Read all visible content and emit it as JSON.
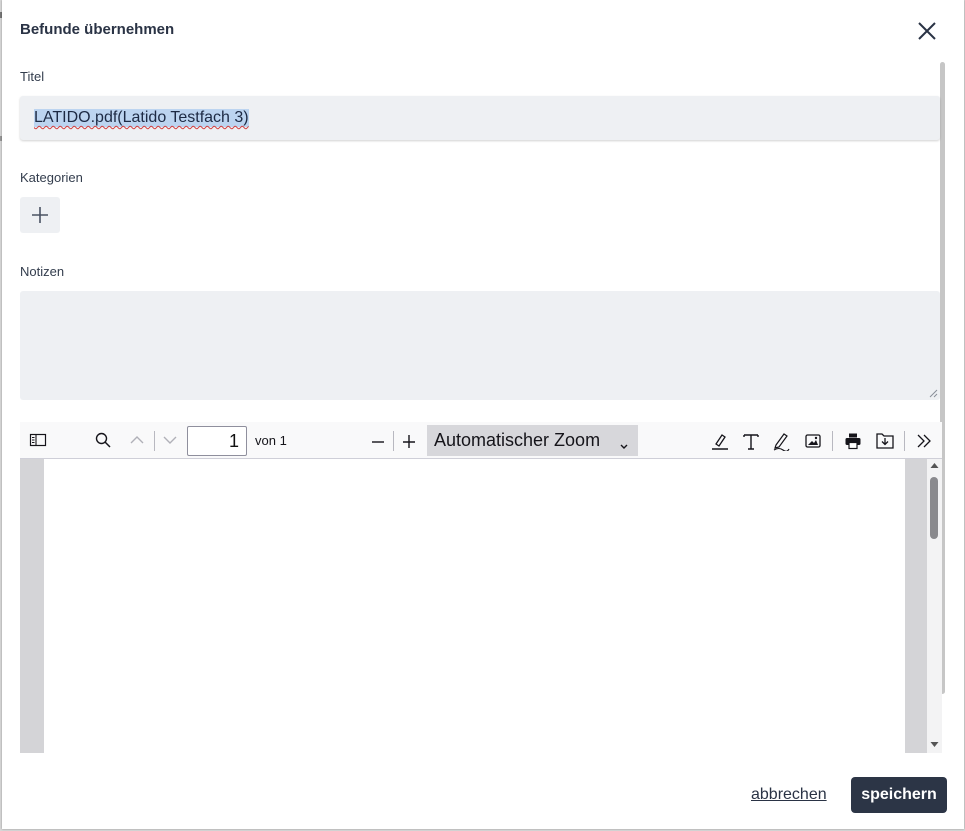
{
  "dialog": {
    "title": "Befunde übernehmen",
    "close_icon": "close-icon"
  },
  "form": {
    "title_label": "Titel",
    "title_value": "LATIDO.pdf(Latido Testfach 3)",
    "categories_label": "Kategorien",
    "add_icon": "plus-icon",
    "notes_label": "Notizen",
    "notes_value": ""
  },
  "pdf_viewer": {
    "toolbar": {
      "sidebar_icon": "sidebar-toggle-icon",
      "search_icon": "search-icon",
      "prev_icon": "chevron-up-icon",
      "next_icon": "chevron-down-icon",
      "page_number": "1",
      "page_of": "von 1",
      "zoom_out_icon": "minus-icon",
      "zoom_in_icon": "plus-icon",
      "zoom_value": "Automatischer Zoom",
      "highlight_icon": "highlight-icon",
      "text_icon": "text-icon",
      "draw_icon": "draw-icon",
      "image_icon": "image-icon",
      "print_icon": "print-icon",
      "save_icon": "save-icon",
      "more_icon": "double-chevron-right-icon"
    }
  },
  "footer": {
    "cancel_label": "abbrechen",
    "save_label": "speichern"
  },
  "colors": {
    "primary_button": "#2c3546",
    "input_bg": "#eef0f3",
    "selection": "#bcd4f0"
  }
}
